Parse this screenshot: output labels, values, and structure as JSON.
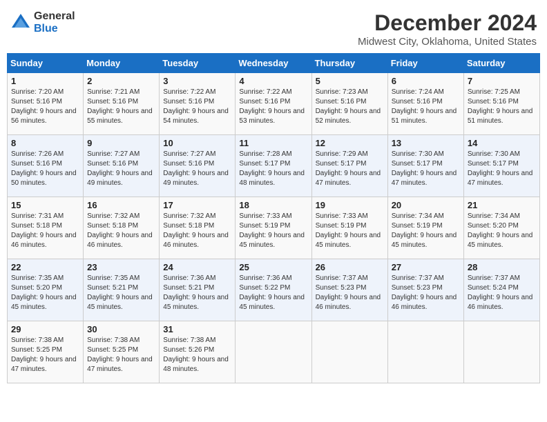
{
  "header": {
    "logo_general": "General",
    "logo_blue": "Blue",
    "month_title": "December 2024",
    "location": "Midwest City, Oklahoma, United States"
  },
  "days_of_week": [
    "Sunday",
    "Monday",
    "Tuesday",
    "Wednesday",
    "Thursday",
    "Friday",
    "Saturday"
  ],
  "weeks": [
    [
      {
        "day": "1",
        "sunrise": "Sunrise: 7:20 AM",
        "sunset": "Sunset: 5:16 PM",
        "daylight": "Daylight: 9 hours and 56 minutes."
      },
      {
        "day": "2",
        "sunrise": "Sunrise: 7:21 AM",
        "sunset": "Sunset: 5:16 PM",
        "daylight": "Daylight: 9 hours and 55 minutes."
      },
      {
        "day": "3",
        "sunrise": "Sunrise: 7:22 AM",
        "sunset": "Sunset: 5:16 PM",
        "daylight": "Daylight: 9 hours and 54 minutes."
      },
      {
        "day": "4",
        "sunrise": "Sunrise: 7:22 AM",
        "sunset": "Sunset: 5:16 PM",
        "daylight": "Daylight: 9 hours and 53 minutes."
      },
      {
        "day": "5",
        "sunrise": "Sunrise: 7:23 AM",
        "sunset": "Sunset: 5:16 PM",
        "daylight": "Daylight: 9 hours and 52 minutes."
      },
      {
        "day": "6",
        "sunrise": "Sunrise: 7:24 AM",
        "sunset": "Sunset: 5:16 PM",
        "daylight": "Daylight: 9 hours and 51 minutes."
      },
      {
        "day": "7",
        "sunrise": "Sunrise: 7:25 AM",
        "sunset": "Sunset: 5:16 PM",
        "daylight": "Daylight: 9 hours and 51 minutes."
      }
    ],
    [
      {
        "day": "8",
        "sunrise": "Sunrise: 7:26 AM",
        "sunset": "Sunset: 5:16 PM",
        "daylight": "Daylight: 9 hours and 50 minutes."
      },
      {
        "day": "9",
        "sunrise": "Sunrise: 7:27 AM",
        "sunset": "Sunset: 5:16 PM",
        "daylight": "Daylight: 9 hours and 49 minutes."
      },
      {
        "day": "10",
        "sunrise": "Sunrise: 7:27 AM",
        "sunset": "Sunset: 5:16 PM",
        "daylight": "Daylight: 9 hours and 49 minutes."
      },
      {
        "day": "11",
        "sunrise": "Sunrise: 7:28 AM",
        "sunset": "Sunset: 5:17 PM",
        "daylight": "Daylight: 9 hours and 48 minutes."
      },
      {
        "day": "12",
        "sunrise": "Sunrise: 7:29 AM",
        "sunset": "Sunset: 5:17 PM",
        "daylight": "Daylight: 9 hours and 47 minutes."
      },
      {
        "day": "13",
        "sunrise": "Sunrise: 7:30 AM",
        "sunset": "Sunset: 5:17 PM",
        "daylight": "Daylight: 9 hours and 47 minutes."
      },
      {
        "day": "14",
        "sunrise": "Sunrise: 7:30 AM",
        "sunset": "Sunset: 5:17 PM",
        "daylight": "Daylight: 9 hours and 47 minutes."
      }
    ],
    [
      {
        "day": "15",
        "sunrise": "Sunrise: 7:31 AM",
        "sunset": "Sunset: 5:18 PM",
        "daylight": "Daylight: 9 hours and 46 minutes."
      },
      {
        "day": "16",
        "sunrise": "Sunrise: 7:32 AM",
        "sunset": "Sunset: 5:18 PM",
        "daylight": "Daylight: 9 hours and 46 minutes."
      },
      {
        "day": "17",
        "sunrise": "Sunrise: 7:32 AM",
        "sunset": "Sunset: 5:18 PM",
        "daylight": "Daylight: 9 hours and 46 minutes."
      },
      {
        "day": "18",
        "sunrise": "Sunrise: 7:33 AM",
        "sunset": "Sunset: 5:19 PM",
        "daylight": "Daylight: 9 hours and 45 minutes."
      },
      {
        "day": "19",
        "sunrise": "Sunrise: 7:33 AM",
        "sunset": "Sunset: 5:19 PM",
        "daylight": "Daylight: 9 hours and 45 minutes."
      },
      {
        "day": "20",
        "sunrise": "Sunrise: 7:34 AM",
        "sunset": "Sunset: 5:19 PM",
        "daylight": "Daylight: 9 hours and 45 minutes."
      },
      {
        "day": "21",
        "sunrise": "Sunrise: 7:34 AM",
        "sunset": "Sunset: 5:20 PM",
        "daylight": "Daylight: 9 hours and 45 minutes."
      }
    ],
    [
      {
        "day": "22",
        "sunrise": "Sunrise: 7:35 AM",
        "sunset": "Sunset: 5:20 PM",
        "daylight": "Daylight: 9 hours and 45 minutes."
      },
      {
        "day": "23",
        "sunrise": "Sunrise: 7:35 AM",
        "sunset": "Sunset: 5:21 PM",
        "daylight": "Daylight: 9 hours and 45 minutes."
      },
      {
        "day": "24",
        "sunrise": "Sunrise: 7:36 AM",
        "sunset": "Sunset: 5:21 PM",
        "daylight": "Daylight: 9 hours and 45 minutes."
      },
      {
        "day": "25",
        "sunrise": "Sunrise: 7:36 AM",
        "sunset": "Sunset: 5:22 PM",
        "daylight": "Daylight: 9 hours and 45 minutes."
      },
      {
        "day": "26",
        "sunrise": "Sunrise: 7:37 AM",
        "sunset": "Sunset: 5:23 PM",
        "daylight": "Daylight: 9 hours and 46 minutes."
      },
      {
        "day": "27",
        "sunrise": "Sunrise: 7:37 AM",
        "sunset": "Sunset: 5:23 PM",
        "daylight": "Daylight: 9 hours and 46 minutes."
      },
      {
        "day": "28",
        "sunrise": "Sunrise: 7:37 AM",
        "sunset": "Sunset: 5:24 PM",
        "daylight": "Daylight: 9 hours and 46 minutes."
      }
    ],
    [
      {
        "day": "29",
        "sunrise": "Sunrise: 7:38 AM",
        "sunset": "Sunset: 5:25 PM",
        "daylight": "Daylight: 9 hours and 47 minutes."
      },
      {
        "day": "30",
        "sunrise": "Sunrise: 7:38 AM",
        "sunset": "Sunset: 5:25 PM",
        "daylight": "Daylight: 9 hours and 47 minutes."
      },
      {
        "day": "31",
        "sunrise": "Sunrise: 7:38 AM",
        "sunset": "Sunset: 5:26 PM",
        "daylight": "Daylight: 9 hours and 48 minutes."
      },
      null,
      null,
      null,
      null
    ]
  ]
}
